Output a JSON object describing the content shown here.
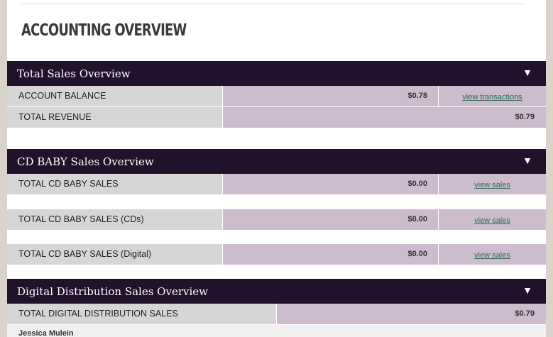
{
  "page": {
    "title": "ACCOUNTING OVERVIEW"
  },
  "sections": {
    "total_sales": {
      "title": "Total Sales Overview",
      "toggle": "▼",
      "rows": {
        "account_balance": {
          "label": "ACCOUNT BALANCE",
          "value": "$0.78",
          "link": "view transactions"
        },
        "total_revenue": {
          "label": "TOTAL REVENUE",
          "value": "$0.79"
        }
      }
    },
    "cd_baby": {
      "title": "CD BABY Sales Overview",
      "toggle": "▼",
      "rows": {
        "total": {
          "label": "TOTAL CD BABY SALES",
          "value": "$0.00",
          "link": "view sales"
        },
        "cds": {
          "label": "TOTAL CD BABY SALES (CDs)",
          "value": "$0.00",
          "link": "view sales"
        },
        "digital": {
          "label": "TOTAL CD BABY SALES (Digital)",
          "value": "$0.00",
          "link": "view sales"
        }
      }
    },
    "digital_distribution": {
      "title": "Digital Distribution Sales Overview",
      "toggle": "▼",
      "rows": {
        "total": {
          "label": "TOTAL DIGITAL DISTRIBUTION SALES",
          "value": "$0.79"
        }
      }
    }
  },
  "footer": {
    "name": "Jessica Mulein"
  },
  "colors": {
    "header_bg": "#22112a",
    "label_bg": "#d6d6d6",
    "value_bg": "#ccbccd",
    "link": "#2f6b57"
  }
}
